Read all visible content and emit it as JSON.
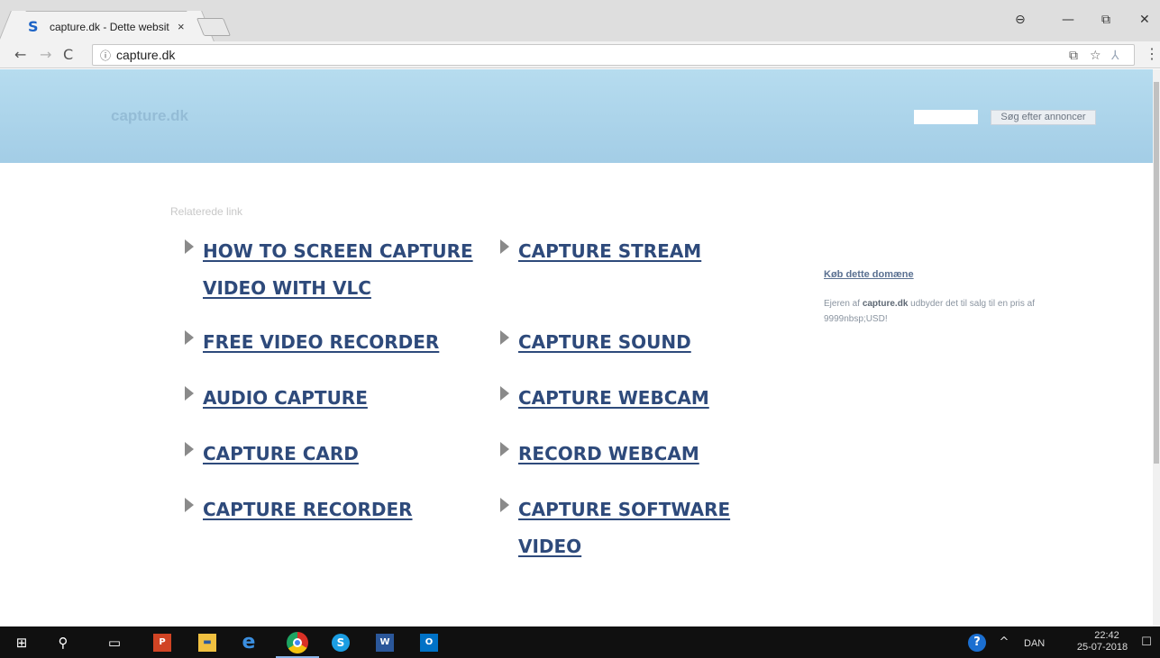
{
  "browser": {
    "tab_title": "capture.dk - Dette websit",
    "tab_close": "×",
    "favicon": "S",
    "url": "capture.dk",
    "info_icon": "ⓘ",
    "back": "←",
    "forward": "→",
    "reload": "C",
    "star": "☆",
    "translate": "⧉",
    "ext": "⅄",
    "menu": "⋮",
    "profile": "⊖",
    "minimize": "—",
    "maximize": "⧉",
    "close": "✕"
  },
  "site": {
    "logo": "capture.dk",
    "search_placeholder": "",
    "search_button": "Søg efter annoncer",
    "related_label": "Relaterede link",
    "links_left": [
      "HOW TO SCREEN CAPTURE VIDEO WITH VLC",
      "FREE VIDEO RECORDER",
      "AUDIO CAPTURE",
      "CAPTURE CARD",
      "CAPTURE RECORDER"
    ],
    "links_right": [
      "CAPTURE STREAM",
      "CAPTURE SOUND",
      "CAPTURE WEBCAM",
      "RECORD WEBCAM",
      "CAPTURE SOFTWARE VIDEO"
    ],
    "buy_title": "Køb dette domæne",
    "buy_desc_prefix": "Ejeren af ",
    "buy_desc_domain": "capture.dk",
    "buy_desc_suffix": " udbyder det til salg til en pris af 9999nbsp;USD!"
  },
  "taskbar": {
    "start": "⊞",
    "search": "⚲",
    "taskview": "▭",
    "ppt": "P",
    "files": "▬",
    "ie": "e",
    "skype": "S",
    "word": "W",
    "outlook": "O",
    "help": "?",
    "chevron": "^",
    "lang": "DAN",
    "time": "22:42",
    "date": "25-07-2018",
    "notify": "☐"
  }
}
